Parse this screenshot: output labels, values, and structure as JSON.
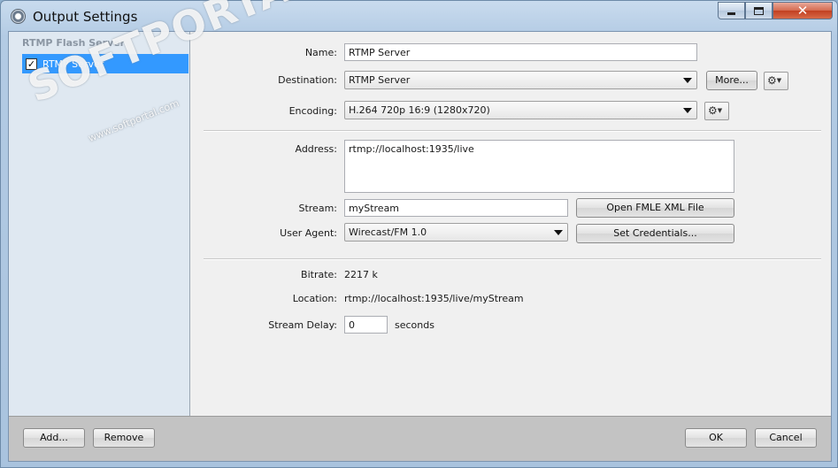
{
  "window": {
    "title": "Output Settings",
    "controls": {
      "minimize": "minimize",
      "maximize": "maximize",
      "close": "✕"
    }
  },
  "sidebar": {
    "group_label": "RTMP Flash Server",
    "items": [
      {
        "label": "RTMP Server",
        "checked": true,
        "check_glyph": "✓"
      }
    ]
  },
  "watermark": {
    "text": "SOFTPORTAL",
    "tm": "™",
    "url": "www.softportal.com"
  },
  "form": {
    "name": {
      "label": "Name:",
      "value": "RTMP Server"
    },
    "destination": {
      "label": "Destination:",
      "value": "RTMP Server",
      "more_button": "More..."
    },
    "encoding": {
      "label": "Encoding:",
      "value": "H.264 720p 16:9 (1280x720)"
    },
    "address": {
      "label": "Address:",
      "value": "rtmp://localhost:1935/live"
    },
    "stream": {
      "label": "Stream:",
      "value": "myStream",
      "button": "Open FMLE XML File"
    },
    "user_agent": {
      "label": "User Agent:",
      "value": "Wirecast/FM 1.0",
      "button": "Set Credentials..."
    },
    "bitrate": {
      "label": "Bitrate:",
      "value": "2217 k"
    },
    "location": {
      "label": "Location:",
      "value": "rtmp://localhost:1935/live/myStream"
    },
    "stream_delay": {
      "label": "Stream Delay:",
      "value": "0",
      "unit": "seconds"
    }
  },
  "footer": {
    "add_button": "Add...",
    "remove_button": "Remove",
    "ok_button": "OK",
    "cancel_button": "Cancel"
  },
  "icons": {
    "gear": "⚙",
    "caret": "▼"
  },
  "colors": {
    "selection": "#3399ff",
    "sidebar_bg": "#dfe8f1",
    "close_button": "#c9452a"
  }
}
